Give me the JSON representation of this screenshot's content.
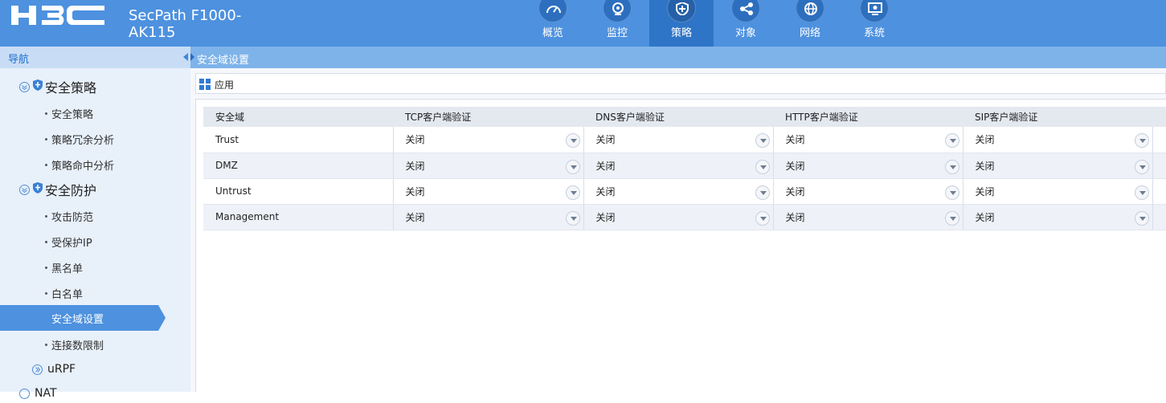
{
  "header": {
    "logo_text": "H3C",
    "product_name": "SecPath F1000-AK115",
    "nav": [
      {
        "label": "概览",
        "icon": "gauge-icon",
        "active": false
      },
      {
        "label": "监控",
        "icon": "webcam-icon",
        "active": false
      },
      {
        "label": "策略",
        "icon": "shield-plus-icon",
        "active": true
      },
      {
        "label": "对象",
        "icon": "share-nodes-icon",
        "active": false
      },
      {
        "label": "网络",
        "icon": "globe-icon",
        "active": false
      },
      {
        "label": "系统",
        "icon": "monitor-gear-icon",
        "active": false
      }
    ]
  },
  "sidebar": {
    "title": "导航",
    "groups": [
      {
        "label": "安全策略",
        "items": [
          "安全策略",
          "策略冗余分析",
          "策略命中分析"
        ]
      },
      {
        "label": "安全防护",
        "items": [
          "攻击防范",
          "受保护IP",
          "黑名单",
          "白名单",
          "安全域设置",
          "连接数限制"
        ]
      }
    ],
    "selected_item": "安全域设置",
    "sub_items": [
      "uRPF",
      "NAT"
    ]
  },
  "breadcrumb": {
    "label": "安全域设置"
  },
  "toolbar": {
    "apply_label": "应用"
  },
  "table": {
    "headers": [
      "安全域",
      "TCP客户端验证",
      "DNS客户端验证",
      "HTTP客户端验证",
      "SIP客户端验证"
    ],
    "rows": [
      {
        "zone": "Trust",
        "values": [
          "关闭",
          "关闭",
          "关闭",
          "关闭"
        ]
      },
      {
        "zone": "DMZ",
        "values": [
          "关闭",
          "关闭",
          "关闭",
          "关闭"
        ]
      },
      {
        "zone": "Untrust",
        "values": [
          "关闭",
          "关闭",
          "关闭",
          "关闭"
        ]
      },
      {
        "zone": "Management",
        "values": [
          "关闭",
          "关闭",
          "关闭",
          "关闭"
        ]
      }
    ]
  }
}
